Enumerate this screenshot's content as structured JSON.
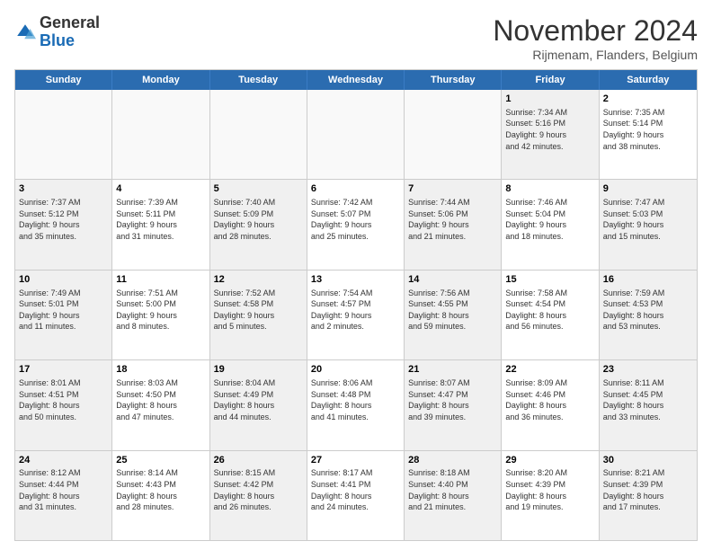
{
  "header": {
    "logo_general": "General",
    "logo_blue": "Blue",
    "month_title": "November 2024",
    "location": "Rijmenam, Flanders, Belgium"
  },
  "weekdays": [
    "Sunday",
    "Monday",
    "Tuesday",
    "Wednesday",
    "Thursday",
    "Friday",
    "Saturday"
  ],
  "rows": [
    [
      {
        "day": "",
        "info": "",
        "shaded": false,
        "empty": true
      },
      {
        "day": "",
        "info": "",
        "shaded": false,
        "empty": true
      },
      {
        "day": "",
        "info": "",
        "shaded": false,
        "empty": true
      },
      {
        "day": "",
        "info": "",
        "shaded": false,
        "empty": true
      },
      {
        "day": "",
        "info": "",
        "shaded": false,
        "empty": true
      },
      {
        "day": "1",
        "info": "Sunrise: 7:34 AM\nSunset: 5:16 PM\nDaylight: 9 hours\nand 42 minutes.",
        "shaded": true,
        "empty": false
      },
      {
        "day": "2",
        "info": "Sunrise: 7:35 AM\nSunset: 5:14 PM\nDaylight: 9 hours\nand 38 minutes.",
        "shaded": false,
        "empty": false
      }
    ],
    [
      {
        "day": "3",
        "info": "Sunrise: 7:37 AM\nSunset: 5:12 PM\nDaylight: 9 hours\nand 35 minutes.",
        "shaded": true,
        "empty": false
      },
      {
        "day": "4",
        "info": "Sunrise: 7:39 AM\nSunset: 5:11 PM\nDaylight: 9 hours\nand 31 minutes.",
        "shaded": false,
        "empty": false
      },
      {
        "day": "5",
        "info": "Sunrise: 7:40 AM\nSunset: 5:09 PM\nDaylight: 9 hours\nand 28 minutes.",
        "shaded": true,
        "empty": false
      },
      {
        "day": "6",
        "info": "Sunrise: 7:42 AM\nSunset: 5:07 PM\nDaylight: 9 hours\nand 25 minutes.",
        "shaded": false,
        "empty": false
      },
      {
        "day": "7",
        "info": "Sunrise: 7:44 AM\nSunset: 5:06 PM\nDaylight: 9 hours\nand 21 minutes.",
        "shaded": true,
        "empty": false
      },
      {
        "day": "8",
        "info": "Sunrise: 7:46 AM\nSunset: 5:04 PM\nDaylight: 9 hours\nand 18 minutes.",
        "shaded": false,
        "empty": false
      },
      {
        "day": "9",
        "info": "Sunrise: 7:47 AM\nSunset: 5:03 PM\nDaylight: 9 hours\nand 15 minutes.",
        "shaded": true,
        "empty": false
      }
    ],
    [
      {
        "day": "10",
        "info": "Sunrise: 7:49 AM\nSunset: 5:01 PM\nDaylight: 9 hours\nand 11 minutes.",
        "shaded": true,
        "empty": false
      },
      {
        "day": "11",
        "info": "Sunrise: 7:51 AM\nSunset: 5:00 PM\nDaylight: 9 hours\nand 8 minutes.",
        "shaded": false,
        "empty": false
      },
      {
        "day": "12",
        "info": "Sunrise: 7:52 AM\nSunset: 4:58 PM\nDaylight: 9 hours\nand 5 minutes.",
        "shaded": true,
        "empty": false
      },
      {
        "day": "13",
        "info": "Sunrise: 7:54 AM\nSunset: 4:57 PM\nDaylight: 9 hours\nand 2 minutes.",
        "shaded": false,
        "empty": false
      },
      {
        "day": "14",
        "info": "Sunrise: 7:56 AM\nSunset: 4:55 PM\nDaylight: 8 hours\nand 59 minutes.",
        "shaded": true,
        "empty": false
      },
      {
        "day": "15",
        "info": "Sunrise: 7:58 AM\nSunset: 4:54 PM\nDaylight: 8 hours\nand 56 minutes.",
        "shaded": false,
        "empty": false
      },
      {
        "day": "16",
        "info": "Sunrise: 7:59 AM\nSunset: 4:53 PM\nDaylight: 8 hours\nand 53 minutes.",
        "shaded": true,
        "empty": false
      }
    ],
    [
      {
        "day": "17",
        "info": "Sunrise: 8:01 AM\nSunset: 4:51 PM\nDaylight: 8 hours\nand 50 minutes.",
        "shaded": true,
        "empty": false
      },
      {
        "day": "18",
        "info": "Sunrise: 8:03 AM\nSunset: 4:50 PM\nDaylight: 8 hours\nand 47 minutes.",
        "shaded": false,
        "empty": false
      },
      {
        "day": "19",
        "info": "Sunrise: 8:04 AM\nSunset: 4:49 PM\nDaylight: 8 hours\nand 44 minutes.",
        "shaded": true,
        "empty": false
      },
      {
        "day": "20",
        "info": "Sunrise: 8:06 AM\nSunset: 4:48 PM\nDaylight: 8 hours\nand 41 minutes.",
        "shaded": false,
        "empty": false
      },
      {
        "day": "21",
        "info": "Sunrise: 8:07 AM\nSunset: 4:47 PM\nDaylight: 8 hours\nand 39 minutes.",
        "shaded": true,
        "empty": false
      },
      {
        "day": "22",
        "info": "Sunrise: 8:09 AM\nSunset: 4:46 PM\nDaylight: 8 hours\nand 36 minutes.",
        "shaded": false,
        "empty": false
      },
      {
        "day": "23",
        "info": "Sunrise: 8:11 AM\nSunset: 4:45 PM\nDaylight: 8 hours\nand 33 minutes.",
        "shaded": true,
        "empty": false
      }
    ],
    [
      {
        "day": "24",
        "info": "Sunrise: 8:12 AM\nSunset: 4:44 PM\nDaylight: 8 hours\nand 31 minutes.",
        "shaded": true,
        "empty": false
      },
      {
        "day": "25",
        "info": "Sunrise: 8:14 AM\nSunset: 4:43 PM\nDaylight: 8 hours\nand 28 minutes.",
        "shaded": false,
        "empty": false
      },
      {
        "day": "26",
        "info": "Sunrise: 8:15 AM\nSunset: 4:42 PM\nDaylight: 8 hours\nand 26 minutes.",
        "shaded": true,
        "empty": false
      },
      {
        "day": "27",
        "info": "Sunrise: 8:17 AM\nSunset: 4:41 PM\nDaylight: 8 hours\nand 24 minutes.",
        "shaded": false,
        "empty": false
      },
      {
        "day": "28",
        "info": "Sunrise: 8:18 AM\nSunset: 4:40 PM\nDaylight: 8 hours\nand 21 minutes.",
        "shaded": true,
        "empty": false
      },
      {
        "day": "29",
        "info": "Sunrise: 8:20 AM\nSunset: 4:39 PM\nDaylight: 8 hours\nand 19 minutes.",
        "shaded": false,
        "empty": false
      },
      {
        "day": "30",
        "info": "Sunrise: 8:21 AM\nSunset: 4:39 PM\nDaylight: 8 hours\nand 17 minutes.",
        "shaded": true,
        "empty": false
      }
    ]
  ]
}
